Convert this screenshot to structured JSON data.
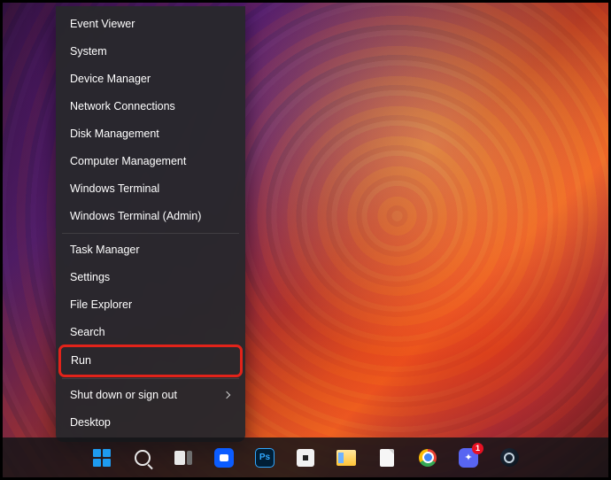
{
  "menu": {
    "group1": [
      "Event Viewer",
      "System",
      "Device Manager",
      "Network Connections",
      "Disk Management",
      "Computer Management",
      "Windows Terminal",
      "Windows Terminal (Admin)"
    ],
    "group2": [
      "Task Manager",
      "Settings",
      "File Explorer",
      "Search"
    ],
    "highlighted": "Run",
    "group3": {
      "shutdown": "Shut down or sign out",
      "desktop": "Desktop"
    }
  },
  "taskbar": {
    "ps_label": "Ps",
    "discord_badge": "1"
  }
}
